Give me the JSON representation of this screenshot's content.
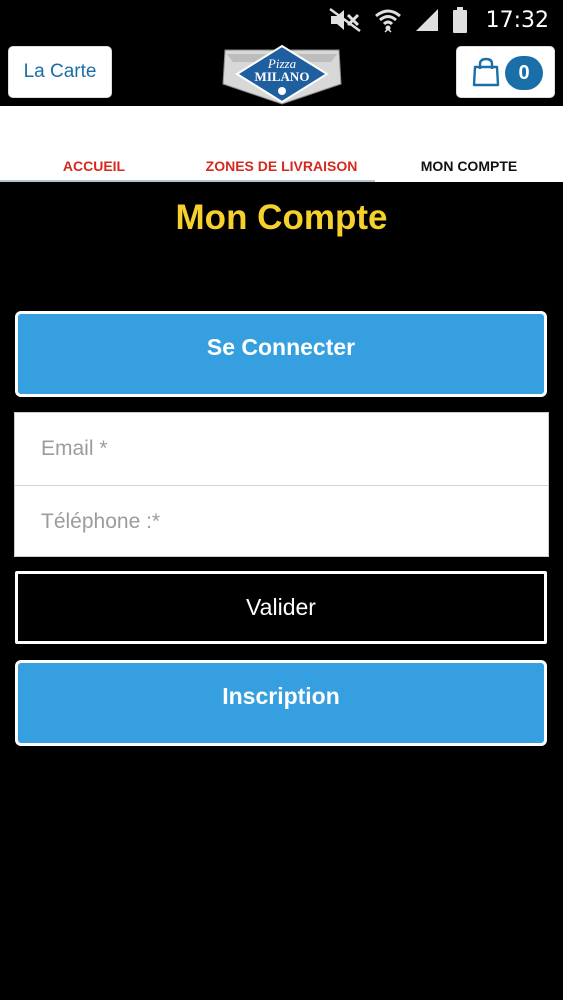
{
  "status_bar": {
    "time": "17:32"
  },
  "header": {
    "menu_button": "La Carte",
    "logo": {
      "line1": "Pizza",
      "line2": "MILANO"
    },
    "cart_count": "0"
  },
  "tabs": [
    {
      "label": "ACCUEIL"
    },
    {
      "label": "ZONES DE LIVRAISON"
    },
    {
      "label": "MON COMPTE"
    }
  ],
  "page": {
    "title": "Mon Compte",
    "login_button": "Se Connecter",
    "email_placeholder": "Email *",
    "phone_placeholder": "Téléphone :*",
    "submit_button": "Valider",
    "signup_button": "Inscription"
  },
  "colors": {
    "accent_blue": "#359fdf",
    "title_yellow": "#f7d12b",
    "tab_red": "#d42a1e",
    "brand_blue": "#1a6fa8"
  },
  "icons": [
    "mute-icon",
    "wifi-icon",
    "signal-icon",
    "battery-icon",
    "shopping-bag-icon"
  ]
}
